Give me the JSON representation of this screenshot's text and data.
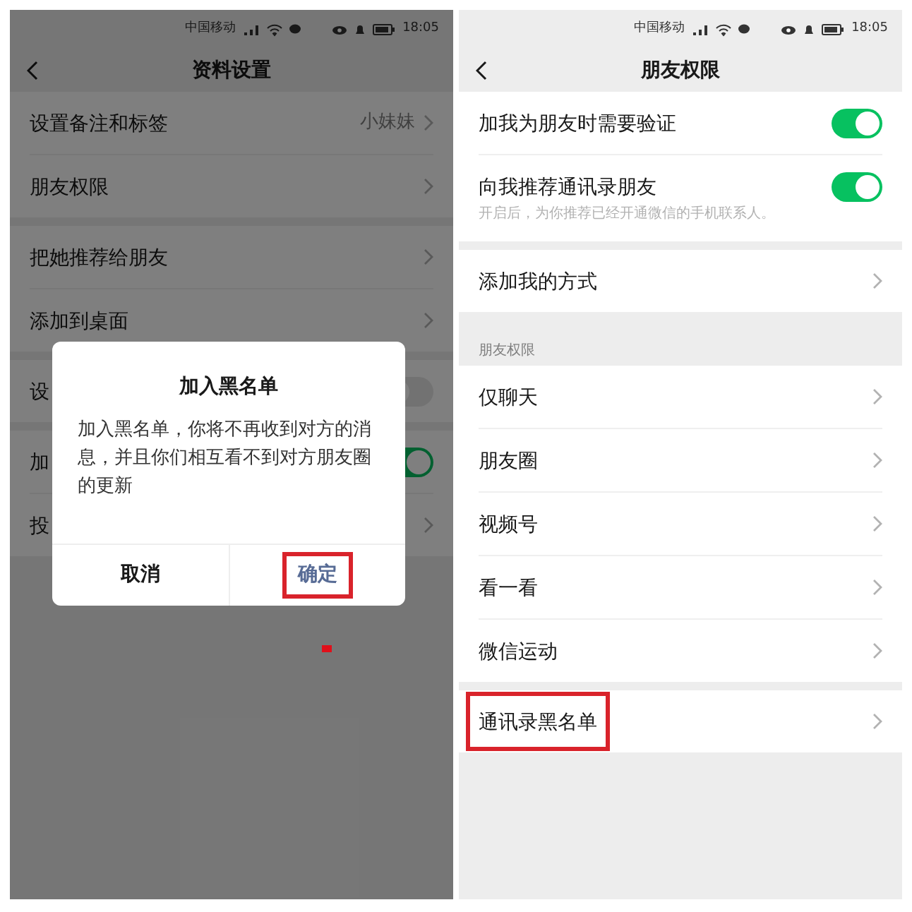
{
  "screens": [
    {
      "status_bar": {
        "carrier": "中国移动",
        "time": "18:05"
      },
      "title": "资料设置",
      "dimmed": true,
      "groups": [
        {
          "rows": [
            {
              "kind": "link",
              "label": "设置备注和标签",
              "value": "小妹妹"
            },
            {
              "kind": "link",
              "label": "朋友权限"
            }
          ]
        },
        {
          "rows": [
            {
              "kind": "link",
              "label": "把她推荐给朋友"
            },
            {
              "kind": "link",
              "label": "添加到桌面"
            }
          ]
        },
        {
          "rows": [
            {
              "kind": "toggle",
              "label": "设",
              "on": false
            }
          ]
        },
        {
          "rows": [
            {
              "kind": "toggle",
              "label": "加",
              "on": true
            },
            {
              "kind": "link",
              "label": "投"
            }
          ]
        }
      ],
      "dialog": {
        "title": "加入黑名单",
        "message": "加入黑名单，你将不再收到对方的消息，并且你们相互看不到对方朋友圈的更新",
        "buttons": [
          {
            "label": "取消",
            "kind": "cancel",
            "highlighted": false
          },
          {
            "label": "确定",
            "kind": "confirm",
            "highlighted": true
          }
        ]
      }
    },
    {
      "status_bar": {
        "carrier": "中国移动",
        "time": "18:05"
      },
      "title": "朋友权限",
      "dimmed": false,
      "groups": [
        {
          "rows": [
            {
              "kind": "toggle",
              "label": "加我为朋友时需要验证",
              "on": true
            },
            {
              "kind": "toggle",
              "label": "向我推荐通讯录朋友",
              "on": true,
              "note": "开启后，为你推荐已经开通微信的手机联系人。"
            }
          ]
        },
        {
          "rows": [
            {
              "kind": "link",
              "label": "添加我的方式"
            }
          ]
        },
        {
          "header": "朋友权限",
          "rows": [
            {
              "kind": "link",
              "label": "仅聊天"
            },
            {
              "kind": "link",
              "label": "朋友圈"
            },
            {
              "kind": "link",
              "label": "视频号"
            },
            {
              "kind": "link",
              "label": "看一看"
            },
            {
              "kind": "link",
              "label": "微信运动"
            }
          ]
        },
        {
          "rows": [
            {
              "kind": "link",
              "label": "通讯录黑名单",
              "highlighted": true
            }
          ]
        }
      ]
    }
  ]
}
